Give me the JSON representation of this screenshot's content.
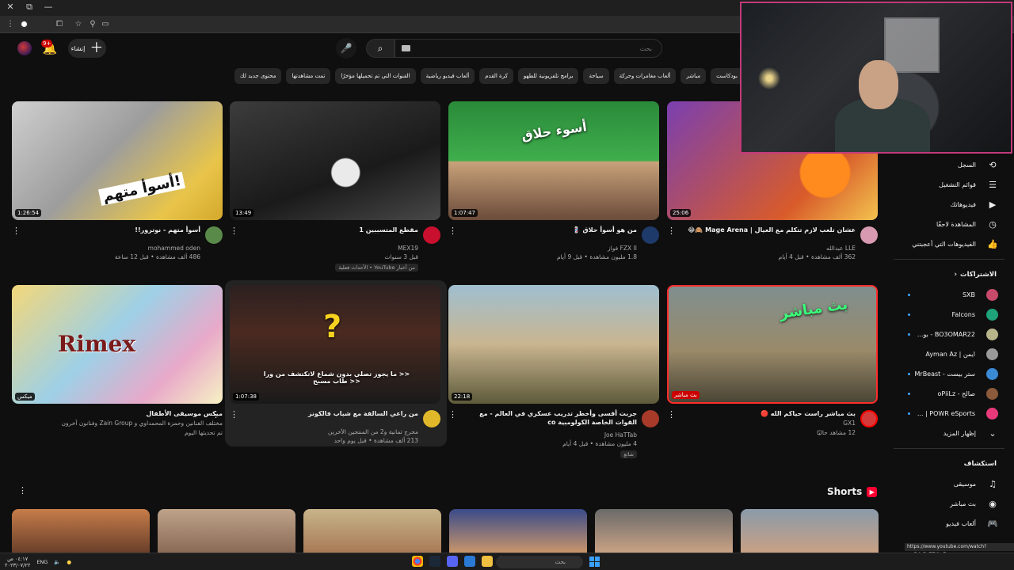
{
  "window": {
    "min_glyph": "—",
    "restore_glyph": "⧉",
    "close_glyph": "✕"
  },
  "header": {
    "create_label": "إنشاء",
    "notification_count": "9+",
    "search_placeholder": "بحث"
  },
  "chips": [
    "بودكاست",
    "مباشر",
    "ألعاب مغامرات وحركة",
    "سياحة",
    "برامج تلفزيونية للطهو",
    "كرة القدم",
    "ألعاب فيديو رياضية",
    "القنوات التي تم تحميلها مؤخرًا",
    "تمت مشاهدتها",
    "محتوى جديد لك"
  ],
  "videos": [
    {
      "title": "أسوأ متهم - نوترور!!",
      "channel": "mohammed oden",
      "stats": "486 ألف مشاهدة • قبل 12 ساعة",
      "duration": "1:26:54",
      "thumb_text": "أسوأ متهم!",
      "extra": ""
    },
    {
      "title": "مقطع المتسببين 1",
      "channel": "MEX19",
      "stats": "قبل 3 سنوات",
      "duration": "13:49",
      "thumb_text": "",
      "extra": "من أخبار YouTube • الأحداث فعلية"
    },
    {
      "title": "من هو أسوأ حلاق 💈",
      "channel": "FZX II فواز",
      "stats": "1.8 مليون مشاهدة • قبل 9 أيام",
      "duration": "1:07:47",
      "thumb_text": "أسوء حلاق",
      "extra": ""
    },
    {
      "title": "عشان تلعب لازم تتكلم مع العيال | Mage Arena 🙈😂",
      "channel": "LLE عبدالله",
      "stats": "362 ألف مشاهدة • قبل 4 أيام",
      "duration": "25:06",
      "thumb_text": "",
      "extra": ""
    },
    {
      "title": "ميكس موسيقى الأطفال",
      "channel": "مختلف الفنانين وحمزة المحمداوي و Zain Group وفنانون آخرون",
      "stats": "تم تحديثها اليوم",
      "duration": "ميكس",
      "thumb_text": "Rimex",
      "extra": ""
    },
    {
      "title": "من راعي السالفة مع شباب فالكونز",
      "channel": "مخرج ثمانية و2 من المنتجين الآخرين",
      "stats": "213 ألف مشاهدة • قبل يوم واحد",
      "duration": "1:07:38",
      "thumb_text": "<< ما يجوز تصلي بدون شماغ لاتكتشف من ورا  << طاب مسبح",
      "extra": ""
    },
    {
      "title": "جربت أقسى وأخطر تدريب عسكري في العالم - مع القوات الخاصة الكولومبية co",
      "channel": "Joe HaTTab",
      "stats": "4 مليون مشاهدة • قبل 4 أيام",
      "duration": "22:18",
      "thumb_text": "",
      "extra": "شائع"
    },
    {
      "title": "بث مباشر راست  حياكم الله 🔴",
      "channel": "GX1",
      "stats": "12 مشاهد حاليًا",
      "duration": "بث مباشر",
      "thumb_text": "بث مباشر",
      "extra": ""
    }
  ],
  "shorts": {
    "title": "Shorts"
  },
  "sidebar": {
    "you_items": [
      {
        "label": "السجل",
        "icon": "history-icon",
        "glyph": "⟲"
      },
      {
        "label": "قوائم التشغيل",
        "icon": "playlist-icon",
        "glyph": "☰"
      },
      {
        "label": "فيديوهاتك",
        "icon": "your-videos-icon",
        "glyph": "▶"
      },
      {
        "label": "المشاهدة لاحقًا",
        "icon": "watch-later-icon",
        "glyph": "◷"
      },
      {
        "label": "الفيديوهات التي أعجبتني",
        "icon": "like-icon",
        "glyph": "👍"
      }
    ],
    "subscriptions_title": "الاشتراكات",
    "subscriptions": [
      {
        "label": "SXB",
        "color": "#c84a6a"
      },
      {
        "label": "Falcons",
        "color": "#1fa37a"
      },
      {
        "label": "BO3OMAR22 - بو...",
        "color": "#b7b48a"
      },
      {
        "label": "ايمن | Ayman Az",
        "color": "#9a9a9a"
      },
      {
        "label": "ستر بيست - MrBeast",
        "color": "#3a8ad6"
      },
      {
        "label": "صالح - oPiiLz",
        "color": "#8a5a3a"
      },
      {
        "label": "POWR eSports | ...",
        "color": "#e83a7a"
      }
    ],
    "show_more": "إظهار المزيد",
    "explore_title": "استكشاف",
    "explore": [
      {
        "label": "موسيقى",
        "icon": "music-icon",
        "glyph": "♫"
      },
      {
        "label": "بث مباشر",
        "icon": "live-icon",
        "glyph": "◉"
      },
      {
        "label": "ألعاب فيديو",
        "icon": "gaming-icon",
        "glyph": "🎮"
      }
    ]
  },
  "status_url": "https://www.youtube.com/watch?v=D4sFqZ7KtgE",
  "taskbar": {
    "time": "٠٤:١٧ ص",
    "date": "٢٠٢٣/٠٧/٢٢",
    "lang": "ENG",
    "search": "بحث"
  }
}
